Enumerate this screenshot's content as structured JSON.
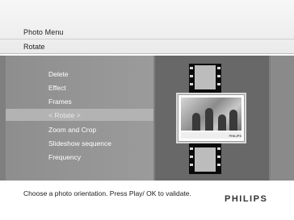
{
  "header": {
    "breadcrumb_1": "Photo Menu",
    "breadcrumb_2": "Rotate"
  },
  "menu": {
    "items": [
      {
        "label": "Delete"
      },
      {
        "label": "Effect"
      },
      {
        "label": "Frames"
      },
      {
        "label": "< Rotate >",
        "selected": true
      },
      {
        "label": "Zoom and Crop"
      },
      {
        "label": "Slideshow sequence"
      },
      {
        "label": "Frequency"
      }
    ]
  },
  "preview": {
    "frame_brand": "PHILIPS"
  },
  "footer": {
    "help": "Choose a photo orientation. Press Play/ OK to validate.",
    "brand": "PHILIPS"
  },
  "colors": {
    "menu_bg": "#9a9a9a",
    "highlight": "#b3b3b3",
    "preview_bg": "#686868",
    "film": "#0b0b0b"
  }
}
